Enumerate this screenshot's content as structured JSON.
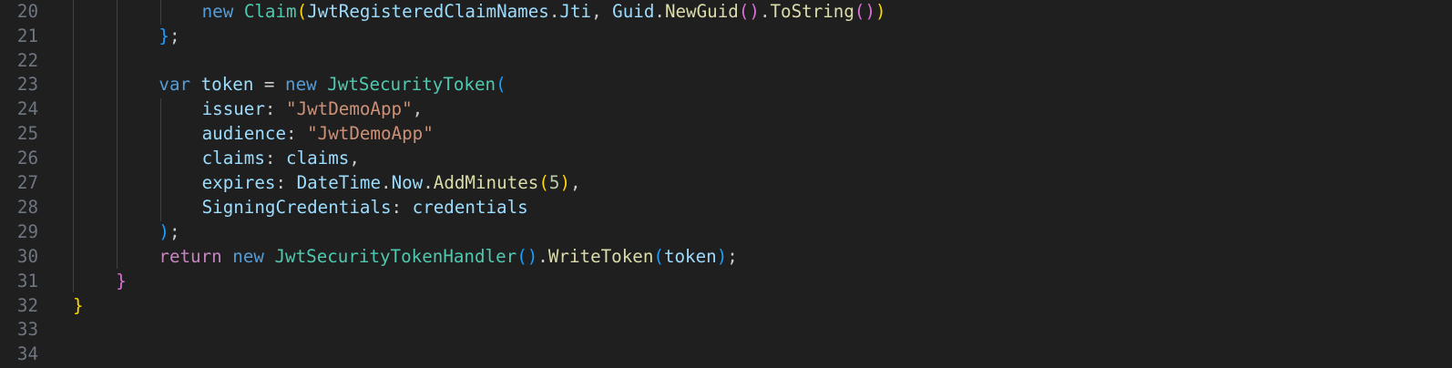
{
  "editor": {
    "lines": [
      {
        "num": "20",
        "indent": 3,
        "tokens": [
          {
            "t": "new",
            "c": "kw"
          },
          {
            "t": " ",
            "c": "pun"
          },
          {
            "t": "Claim",
            "c": "ty"
          },
          {
            "t": "(",
            "c": "b1"
          },
          {
            "t": "JwtRegisteredClaimNames",
            "c": "id"
          },
          {
            "t": ".",
            "c": "pun"
          },
          {
            "t": "Jti",
            "c": "id"
          },
          {
            "t": ", ",
            "c": "pun"
          },
          {
            "t": "Guid",
            "c": "id"
          },
          {
            "t": ".",
            "c": "pun"
          },
          {
            "t": "NewGuid",
            "c": "fn"
          },
          {
            "t": "()",
            "c": "b2"
          },
          {
            "t": ".",
            "c": "pun"
          },
          {
            "t": "ToString",
            "c": "fn"
          },
          {
            "t": "()",
            "c": "b2"
          },
          {
            "t": ")",
            "c": "b1"
          }
        ]
      },
      {
        "num": "21",
        "indent": 2,
        "tokens": [
          {
            "t": "}",
            "c": "b3"
          },
          {
            "t": ";",
            "c": "pun"
          }
        ]
      },
      {
        "num": "22",
        "indent": 0,
        "tokens": []
      },
      {
        "num": "23",
        "indent": 2,
        "tokens": [
          {
            "t": "var",
            "c": "kw"
          },
          {
            "t": " ",
            "c": "pun"
          },
          {
            "t": "token",
            "c": "id"
          },
          {
            "t": " = ",
            "c": "pun"
          },
          {
            "t": "new",
            "c": "kw"
          },
          {
            "t": " ",
            "c": "pun"
          },
          {
            "t": "JwtSecurityToken",
            "c": "ty"
          },
          {
            "t": "(",
            "c": "b3"
          }
        ]
      },
      {
        "num": "24",
        "indent": 3,
        "tokens": [
          {
            "t": "issuer",
            "c": "id"
          },
          {
            "t": ": ",
            "c": "pun"
          },
          {
            "t": "\"JwtDemoApp\"",
            "c": "str"
          },
          {
            "t": ",",
            "c": "pun"
          }
        ]
      },
      {
        "num": "25",
        "indent": 3,
        "tokens": [
          {
            "t": "audience",
            "c": "id"
          },
          {
            "t": ": ",
            "c": "pun"
          },
          {
            "t": "\"JwtDemoApp\"",
            "c": "str"
          }
        ]
      },
      {
        "num": "26",
        "indent": 3,
        "tokens": [
          {
            "t": "claims",
            "c": "id"
          },
          {
            "t": ": ",
            "c": "pun"
          },
          {
            "t": "claims",
            "c": "id"
          },
          {
            "t": ",",
            "c": "pun"
          }
        ]
      },
      {
        "num": "27",
        "indent": 3,
        "tokens": [
          {
            "t": "expires",
            "c": "id"
          },
          {
            "t": ": ",
            "c": "pun"
          },
          {
            "t": "DateTime",
            "c": "id"
          },
          {
            "t": ".",
            "c": "pun"
          },
          {
            "t": "Now",
            "c": "id"
          },
          {
            "t": ".",
            "c": "pun"
          },
          {
            "t": "AddMinutes",
            "c": "fn"
          },
          {
            "t": "(",
            "c": "b1"
          },
          {
            "t": "5",
            "c": "num"
          },
          {
            "t": ")",
            "c": "b1"
          },
          {
            "t": ",",
            "c": "pun"
          }
        ]
      },
      {
        "num": "28",
        "indent": 3,
        "tokens": [
          {
            "t": "SigningCredentials",
            "c": "id"
          },
          {
            "t": ": ",
            "c": "pun"
          },
          {
            "t": "credentials",
            "c": "id"
          }
        ]
      },
      {
        "num": "29",
        "indent": 2,
        "tokens": [
          {
            "t": ")",
            "c": "b3"
          },
          {
            "t": ";",
            "c": "pun"
          }
        ]
      },
      {
        "num": "30",
        "indent": 2,
        "tokens": [
          {
            "t": "return",
            "c": "ctl"
          },
          {
            "t": " ",
            "c": "pun"
          },
          {
            "t": "new",
            "c": "kw"
          },
          {
            "t": " ",
            "c": "pun"
          },
          {
            "t": "JwtSecurityTokenHandler",
            "c": "ty"
          },
          {
            "t": "()",
            "c": "b3"
          },
          {
            "t": ".",
            "c": "pun"
          },
          {
            "t": "WriteToken",
            "c": "fn"
          },
          {
            "t": "(",
            "c": "b3"
          },
          {
            "t": "token",
            "c": "id"
          },
          {
            "t": ")",
            "c": "b3"
          },
          {
            "t": ";",
            "c": "pun"
          }
        ]
      },
      {
        "num": "31",
        "indent": 1,
        "tokens": [
          {
            "t": "}",
            "c": "b2"
          }
        ]
      },
      {
        "num": "32",
        "indent": 0,
        "tokens": [
          {
            "t": "}",
            "c": "b1"
          }
        ]
      },
      {
        "num": "33",
        "indent": 0,
        "tokens": []
      },
      {
        "num": "34",
        "indent": 0,
        "tokens": []
      }
    ]
  }
}
